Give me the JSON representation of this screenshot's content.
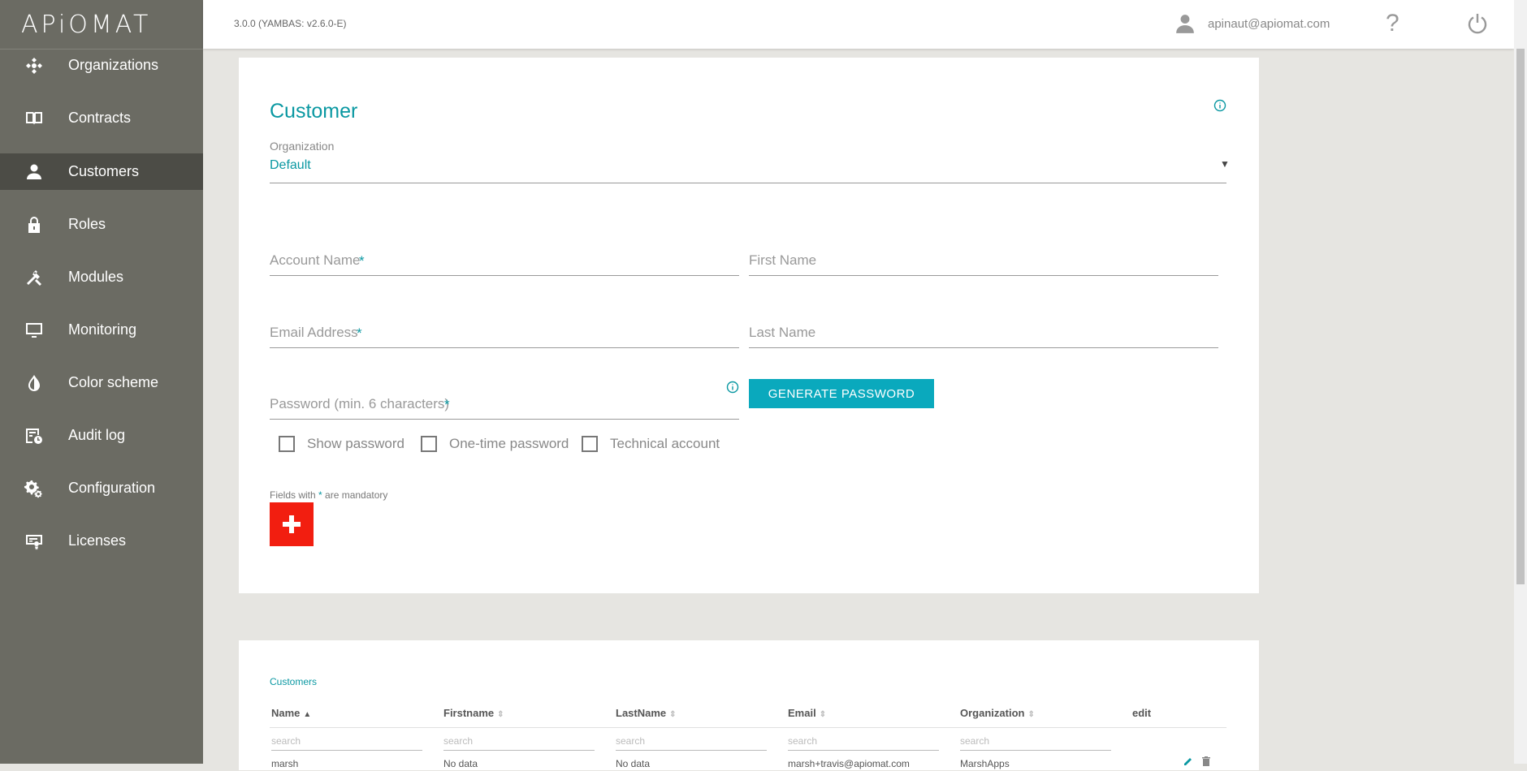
{
  "app": {
    "logo_text": "APiOMAT",
    "version": "3.0.0 (YAMBAS: v2.6.0-E)"
  },
  "user": {
    "email": "apinaut@apiomat.com",
    "help_label": "?"
  },
  "sidebar": {
    "items": [
      {
        "label": "Organizations",
        "icon": "organizations-icon"
      },
      {
        "label": "Contracts",
        "icon": "book-icon"
      },
      {
        "label": "Customers",
        "icon": "person-icon",
        "active": true
      },
      {
        "label": "Roles",
        "icon": "lock-icon"
      },
      {
        "label": "Modules",
        "icon": "tools-icon"
      },
      {
        "label": "Monitoring",
        "icon": "monitor-icon"
      },
      {
        "label": "Color scheme",
        "icon": "drop-icon"
      },
      {
        "label": "Audit log",
        "icon": "audit-icon"
      },
      {
        "label": "Configuration",
        "icon": "gears-icon"
      },
      {
        "label": "Licenses",
        "icon": "license-icon"
      }
    ]
  },
  "form": {
    "title": "Customer",
    "organization_label": "Organization",
    "organization_value": "Default",
    "account_name_placeholder": "Account Name",
    "first_name_placeholder": "First Name",
    "email_placeholder": "Email Address",
    "last_name_placeholder": "Last Name",
    "password_placeholder": "Password (min. 6 characters)",
    "required_mark": "*",
    "generate_password_label": "GENERATE PASSWORD",
    "show_password_label": "Show password",
    "one_time_password_label": "One-time password",
    "technical_account_label": "Technical account",
    "mandatory_prefix": "Fields with ",
    "mandatory_star": "*",
    "mandatory_suffix": " are mandatory"
  },
  "table": {
    "title": "Customers",
    "columns": [
      "Name",
      "Firstname",
      "LastName",
      "Email",
      "Organization",
      "edit"
    ],
    "sort_active": "▲",
    "sort_idle": "⇕",
    "search_placeholder": "search",
    "rows": [
      [
        "marsh",
        "No data",
        "No data",
        "marsh+travis@apiomat.com",
        "MarshApps"
      ]
    ]
  },
  "colors": {
    "accent": "#0a98a2",
    "button": "#0aa9bd",
    "add": "#f21e10",
    "sidebar": "#6b6b63",
    "sidebar_active": "#4c4c46"
  }
}
